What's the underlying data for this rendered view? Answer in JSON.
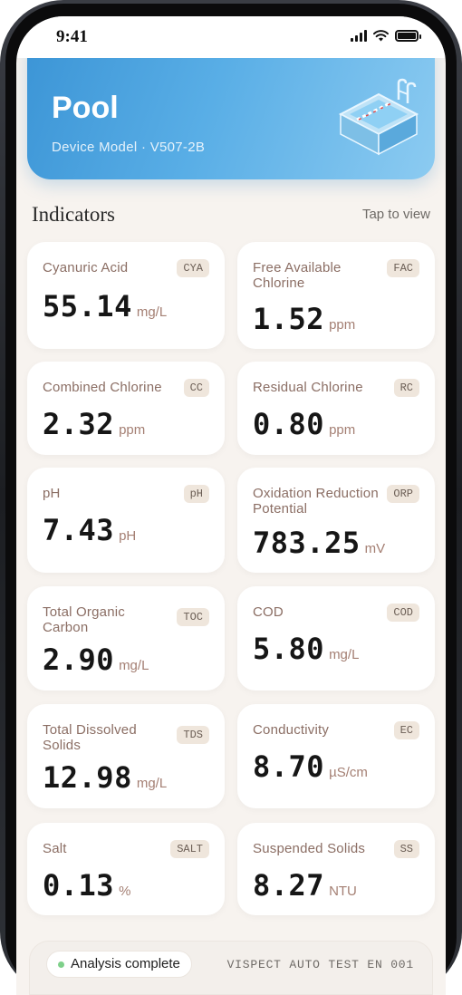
{
  "status_bar": {
    "time": "9:41",
    "icons": [
      "signal-icon",
      "wifi-icon",
      "battery-icon"
    ]
  },
  "header": {
    "title": "Pool",
    "subtitle": "Device Model · V507-2B",
    "illustration": "pool-icon"
  },
  "section": {
    "title": "Indicators",
    "action": "Tap to view"
  },
  "indicators": [
    {
      "label": "Cyanuric Acid",
      "code": "CYA",
      "value": "55.14",
      "unit": "mg/L"
    },
    {
      "label": "Free Available Chlorine",
      "code": "FAC",
      "value": "1.52",
      "unit": "ppm"
    },
    {
      "label": "Combined Chlorine",
      "code": "CC",
      "value": "2.32",
      "unit": "ppm"
    },
    {
      "label": "Residual Chlorine",
      "code": "RC",
      "value": "0.80",
      "unit": "ppm"
    },
    {
      "label": "pH",
      "code": "pH",
      "value": "7.43",
      "unit": "pH"
    },
    {
      "label": "Oxidation Reduction Potential",
      "code": "ORP",
      "value": "783.25",
      "unit": "mV"
    },
    {
      "label": "Total Organic Carbon",
      "code": "TOC",
      "value": "2.90",
      "unit": "mg/L"
    },
    {
      "label": "COD",
      "code": "COD",
      "value": "5.80",
      "unit": "mg/L"
    },
    {
      "label": "Total Dissolved Solids",
      "code": "TDS",
      "value": "12.98",
      "unit": "mg/L"
    },
    {
      "label": "Conductivity",
      "code": "EC",
      "value": "8.70",
      "unit": "µS/cm"
    },
    {
      "label": "Salt",
      "code": "SALT",
      "value": "0.13",
      "unit": "%"
    },
    {
      "label": "Suspended Solids",
      "code": "SS",
      "value": "8.27",
      "unit": "NTU"
    }
  ],
  "footer": {
    "status": "Analysis complete",
    "status_color": "#7ed08a",
    "code": "VISPECT AUTO TEST EN 001"
  },
  "colors": {
    "accent": "#3c95d6",
    "label": "#8b6e64",
    "background": "#f7f3ef"
  }
}
